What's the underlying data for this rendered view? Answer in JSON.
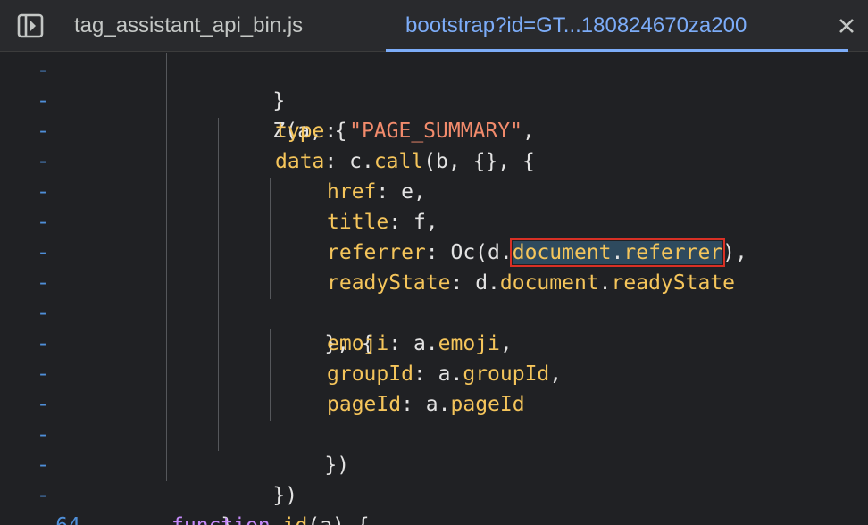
{
  "tabs": [
    {
      "label": "tag_assistant_api_bin.js",
      "active": false
    },
    {
      "label": "bootstrap?id=GT...180824670za200",
      "active": true
    }
  ],
  "icons": {
    "panel_toggle": "sidebar-toggle-icon",
    "close": "close-icon"
  },
  "colors": {
    "accent": "#7cacf8",
    "property": "#f5c55b",
    "string": "#f28b6c",
    "keyword": "#c58af9",
    "highlight_border": "#d93025"
  },
  "gutter": [
    "-",
    "-",
    "-",
    "-",
    "-",
    "-",
    "-",
    "-",
    "-",
    "-",
    "-",
    "-",
    "-",
    "-",
    "-",
    "-",
    "64"
  ],
  "code": {
    "l1": "}",
    "l2": "Z(a, {",
    "l3_key": "type",
    "l3_val": "\"PAGE_SUMMARY\"",
    "l4_key": "data",
    "l4_obj": "c",
    "l4_fn": "call",
    "l4_rest": "(b, {}, {",
    "l5_key": "href",
    "l5_val": "e,",
    "l6_key": "title",
    "l6_val": "f,",
    "l7_key": "referrer",
    "l7_pre": "Oc(d.",
    "l7_hl_a": "document",
    "l7_hl_b": "referrer",
    "l7_post": "),",
    "l8_key": "readyState",
    "l8_obj": "d.",
    "l8_a": "document",
    "l8_b": "readyState",
    "l9": "}, {",
    "l10_key": "emoji",
    "l10_obj": "a.",
    "l10_val": "emoji",
    "l11_key": "groupId",
    "l11_obj": "a.",
    "l11_val": "groupId",
    "l12_key": "pageId",
    "l12_obj": "a.",
    "l12_val": "pageId",
    "l13": "})",
    "l14": "})",
    "l15": "}",
    "l16_kw": "function",
    "l16_name": "id",
    "l16_rest": "(a) {"
  }
}
